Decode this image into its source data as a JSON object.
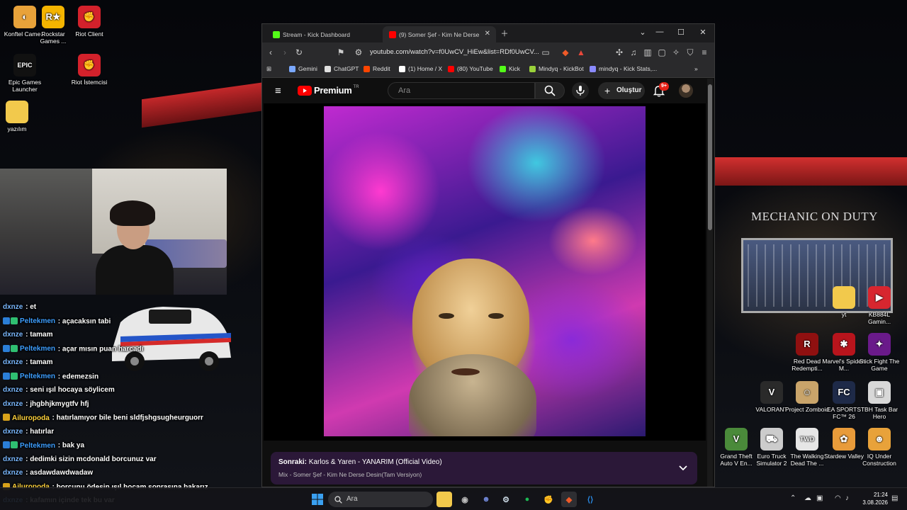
{
  "desktop": {
    "icons_left": [
      {
        "label": "Konftel Came...",
        "name": "konftel-camera-icon",
        "color": "#e8a23a",
        "glyph": "◐"
      },
      {
        "label": "Rockstar Games ...",
        "name": "rockstar-games-icon",
        "color": "#f4b400",
        "glyph": "R★"
      },
      {
        "label": "Riot Client",
        "name": "riot-client-icon",
        "color": "#d3212b",
        "glyph": "✊"
      },
      {
        "label": "Epic Games Launcher",
        "name": "epic-games-icon",
        "color": "#111111",
        "glyph": "EPIC"
      },
      {
        "label": "Riot İstemcisi",
        "name": "riot-istemcisi-icon",
        "color": "#d3212b",
        "glyph": "✊"
      },
      {
        "label": "yazılım",
        "name": "folder-icon",
        "color": "#f2c94c",
        "glyph": ""
      }
    ],
    "icons_right": [
      {
        "label": "yt",
        "name": "folder-yt-icon",
        "color": "#f2c94c",
        "glyph": ""
      },
      {
        "label": "KB884L Gamin...",
        "name": "kb884l-icon",
        "color": "#d7262f",
        "glyph": "▶"
      },
      {
        "label": "Red Dead Redempti...",
        "name": "red-dead-icon",
        "color": "#8f1010",
        "glyph": "R"
      },
      {
        "label": "Marvel's Spider-M...",
        "name": "spider-man-icon",
        "color": "#b8141c",
        "glyph": "✱"
      },
      {
        "label": "Stick Fight The Game",
        "name": "stick-fight-icon",
        "color": "#6a1a8a",
        "glyph": "✦"
      },
      {
        "label": "VALORANT",
        "name": "valorant-icon",
        "color": "#2a2a2a",
        "glyph": "V"
      },
      {
        "label": "Project Zomboid",
        "name": "project-zomboid-icon",
        "color": "#c9a46a",
        "glyph": "☺"
      },
      {
        "label": "EA SPORTS FC™ 26",
        "name": "ea-fc-icon",
        "color": "#1e2a48",
        "glyph": "FC"
      },
      {
        "label": "TBH Task Bar Hero",
        "name": "tbh-icon",
        "color": "#d8d8d8",
        "glyph": "▣"
      },
      {
        "label": "Grand Theft Auto V En...",
        "name": "gta-v-icon",
        "color": "#4a8a3a",
        "glyph": "V"
      },
      {
        "label": "Euro Truck Simulator 2",
        "name": "euro-truck-icon",
        "color": "#cccccc",
        "glyph": "⛟"
      },
      {
        "label": "The Walking Dead The ...",
        "name": "walking-dead-icon",
        "color": "#e6e6e6",
        "glyph": "TWD"
      },
      {
        "label": "Stardew Valley",
        "name": "stardew-icon",
        "color": "#e89b3a",
        "glyph": "✿"
      },
      {
        "label": "IQ Under Construction",
        "name": "iq-under-construction-icon",
        "color": "#e8a23a",
        "glyph": "☻"
      }
    ],
    "store_sign": "MECHANIC ON DUTY"
  },
  "chat": {
    "messages": [
      {
        "user": "dxnze",
        "text": "et",
        "user_color": "#7ab8ff",
        "badges": []
      },
      {
        "user": "Peltekmen",
        "text": "açacaksın tabi",
        "user_color": "#3d9eff",
        "badges": [
          "#2b7fd8",
          "#2fbf71"
        ]
      },
      {
        "user": "dxnze",
        "text": "tamam",
        "user_color": "#7ab8ff",
        "badges": []
      },
      {
        "user": "Peltekmen",
        "text": "açar mısın puan harcadı",
        "user_color": "#3d9eff",
        "badges": [
          "#2b7fd8",
          "#2fbf71"
        ]
      },
      {
        "user": "dxnze",
        "text": "tamam",
        "user_color": "#7ab8ff",
        "badges": []
      },
      {
        "user": "Peltekmen",
        "text": "edemezsin",
        "user_color": "#3d9eff",
        "badges": [
          "#2b7fd8",
          "#2fbf71"
        ]
      },
      {
        "user": "dxnze",
        "text": "seni ışıl hocaya söylicem",
        "user_color": "#7ab8ff",
        "badges": []
      },
      {
        "user": "dxnze",
        "text": "jhgbhjkmygtfv hfj",
        "user_color": "#7ab8ff",
        "badges": []
      },
      {
        "user": "Ailuropoda",
        "text": "hatırlamıyor bile beni sldfjshgsugheurguorr",
        "user_color": "#ffd23d",
        "badges": [
          "#d8a21a"
        ]
      },
      {
        "user": "dxnze",
        "text": "hatırlar",
        "user_color": "#7ab8ff",
        "badges": []
      },
      {
        "user": "Peltekmen",
        "text": "bak ya",
        "user_color": "#3d9eff",
        "badges": [
          "#2b7fd8",
          "#2fbf71"
        ]
      },
      {
        "user": "dxnze",
        "text": "dedimki sizin mcdonald borcunuz var",
        "user_color": "#7ab8ff",
        "badges": []
      },
      {
        "user": "dxnze",
        "text": "asdawdawdwadaw",
        "user_color": "#7ab8ff",
        "badges": []
      },
      {
        "user": "Ailuropoda",
        "text": "borcunu ödesin ışıl hocam sonrasına bakarız",
        "user_color": "#ffd23d",
        "badges": [
          "#d8a21a"
        ]
      },
      {
        "user": "dxnze",
        "text": "kafamın içinde tek bu var",
        "user_color": "#7ab8ff",
        "badges": []
      }
    ]
  },
  "browser": {
    "tabs": [
      {
        "label": "Stream - Kick Dashboard",
        "favicon_color": "#53fc18",
        "active": false
      },
      {
        "label": "(9) Somer Şef - Kim Ne Derse",
        "favicon_color": "#ff0000",
        "active": true
      }
    ],
    "url": "youtube.com/watch?v=f0UwCV_HiEw&list=RDf0UwCV...",
    "bookmarks": [
      {
        "label": "Gemini",
        "color": "#7aa8ff"
      },
      {
        "label": "ChatGPT",
        "color": "#e0e0e0"
      },
      {
        "label": "Reddit",
        "color": "#ff4500"
      },
      {
        "label": "(1) Home / X",
        "color": "#ffffff"
      },
      {
        "label": "(80) YouTube",
        "color": "#ff0000"
      },
      {
        "label": "Kick",
        "color": "#53fc18"
      },
      {
        "label": "Mindyq - KickBot",
        "color": "#9ad13a"
      },
      {
        "label": "mindyq - Kick Stats,...",
        "color": "#8a8aff"
      }
    ]
  },
  "youtube": {
    "logo_text": "Premium",
    "logo_sup": "TR",
    "search_placeholder": "Ara",
    "create_label": "Oluştur",
    "notification_count": "9+",
    "upnext_prefix": "Sonraki:",
    "upnext_title": "Karlos & Yaren - YANARIM (Official Video)",
    "upnext_sub": "Mix - Somer Şef - Kim Ne Derse Desin(Tam Versiyon)"
  },
  "taskbar": {
    "search_placeholder": "Ara",
    "time": "21:24",
    "date": "3.08.2026"
  }
}
